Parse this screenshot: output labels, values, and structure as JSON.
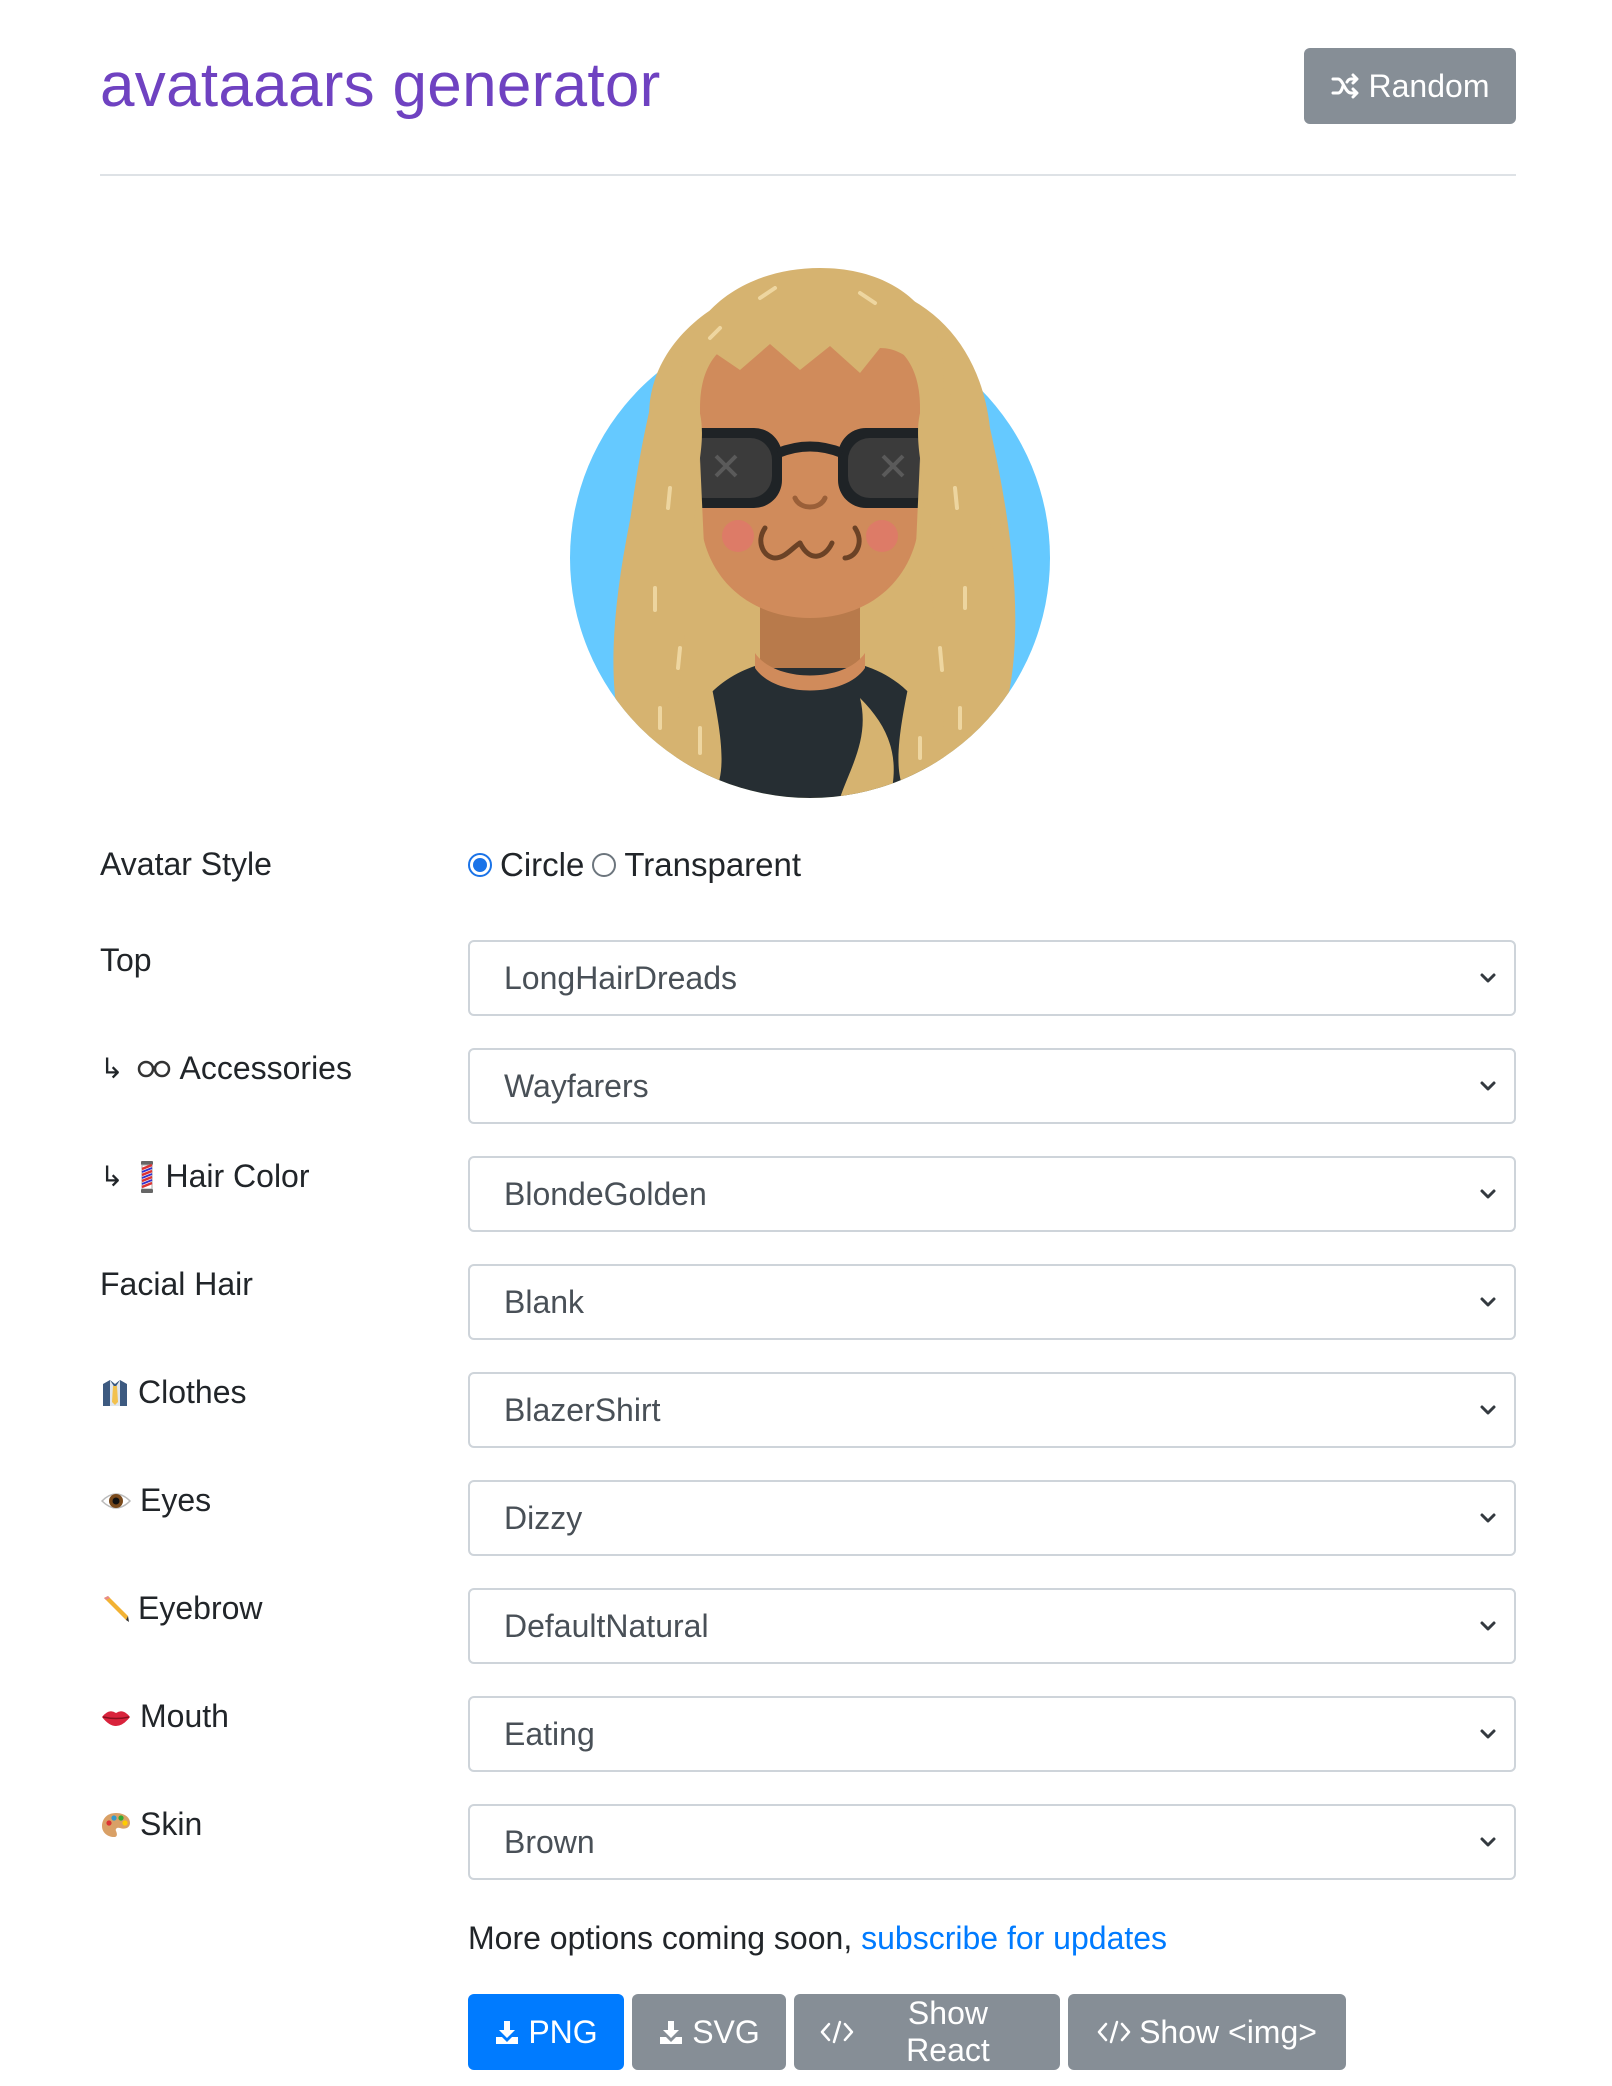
{
  "header": {
    "title": "avataaars generator",
    "random_label": "Random"
  },
  "avatar": {
    "style_options": [
      "Circle",
      "Transparent"
    ],
    "selected_style": "Circle",
    "colors": {
      "background": "#65c9ff",
      "skin": "#d08b5b",
      "hair": "#d6b370",
      "shirt": "#262e33",
      "glasses": "#1f2326"
    }
  },
  "form": {
    "avatar_style_label": "Avatar Style",
    "rows": [
      {
        "key": "top",
        "label": "Top",
        "prefix": "",
        "icon": "",
        "value": "LongHairDreads"
      },
      {
        "key": "accessories",
        "label": "Accessories",
        "prefix": "↳",
        "icon": "glasses-icon",
        "value": "Wayfarers"
      },
      {
        "key": "hair_color",
        "label": "Hair Color",
        "prefix": "↳",
        "icon": "barber-pole-icon",
        "value": "BlondeGolden"
      },
      {
        "key": "facial_hair",
        "label": "Facial Hair",
        "prefix": "",
        "icon": "",
        "value": "Blank"
      },
      {
        "key": "clothes",
        "label": "Clothes",
        "prefix": "",
        "icon": "necktie-shirt-icon",
        "value": "BlazerShirt"
      },
      {
        "key": "eyes",
        "label": "Eyes",
        "prefix": "",
        "icon": "eye-icon",
        "value": "Dizzy"
      },
      {
        "key": "eyebrow",
        "label": "Eyebrow",
        "prefix": "",
        "icon": "pencil-icon",
        "value": "DefaultNatural"
      },
      {
        "key": "mouth",
        "label": "Mouth",
        "prefix": "",
        "icon": "lips-icon",
        "value": "Eating"
      },
      {
        "key": "skin",
        "label": "Skin",
        "prefix": "",
        "icon": "palette-icon",
        "value": "Brown"
      }
    ]
  },
  "footer": {
    "more_text": "More options coming soon, ",
    "subscribe_link": "subscribe for updates",
    "buttons": {
      "png": "PNG",
      "svg": "SVG",
      "show_react": "Show React",
      "show_img": "Show <img>"
    }
  },
  "colors": {
    "title": "#6f42c1",
    "primary": "#007bff",
    "secondary": "#868e96",
    "link": "#007bff"
  }
}
